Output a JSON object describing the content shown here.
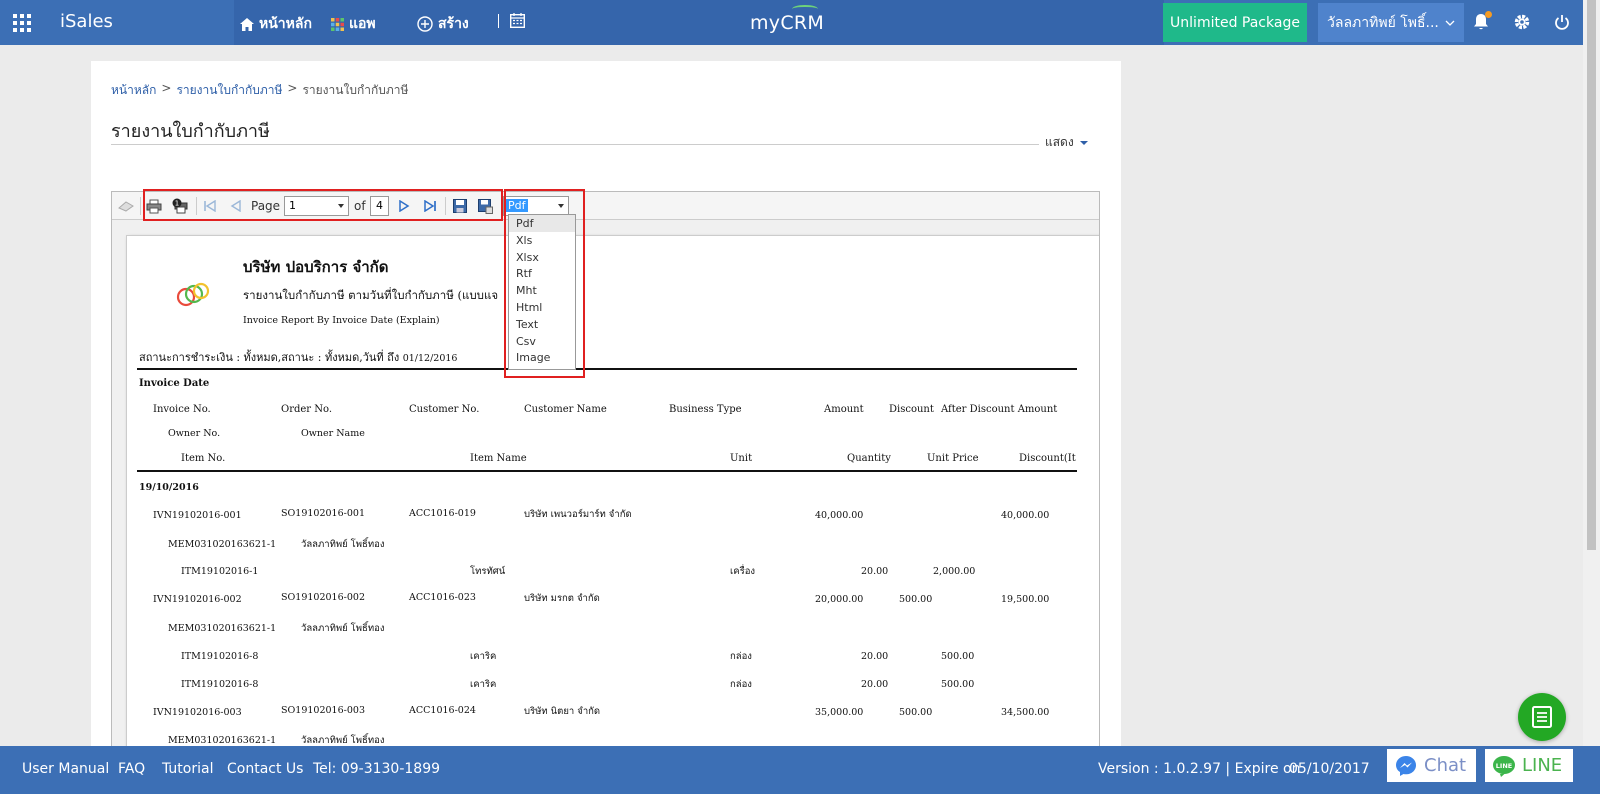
{
  "topbar": {
    "brand": "iSales",
    "nav": [
      {
        "label": "หน้าหลัก",
        "icon": "home-icon"
      },
      {
        "label": "แอพ",
        "icon": "apps-color-icon"
      },
      {
        "label": "สร้าง",
        "icon": "plus-circle-icon"
      }
    ],
    "logo": "myCRM",
    "package": "Unlimited Package",
    "user": "วัลลภาทิพย์ โพธิ์...",
    "colors": {
      "bar": "#3c6fb5",
      "package": "#1fb98a"
    }
  },
  "breadcrumb": {
    "items": [
      "หน้าหลัก",
      "รายงานใบกำกับภาษี",
      "รายงานใบกำกับภาษี"
    ],
    "separator": ">"
  },
  "page": {
    "title": "รายงานใบกำกับภาษี",
    "show_label": "แสดง"
  },
  "toolbar": {
    "page_label": "Page",
    "page_value": "1",
    "of_label": "of",
    "page_total": "4",
    "format_value": "Pdf"
  },
  "format_options": [
    "Pdf",
    "Xls",
    "Xlsx",
    "Rtf",
    "Mht",
    "Html",
    "Text",
    "Csv",
    "Image"
  ],
  "report": {
    "company": "บริษัท ปอบริการ จำกัด",
    "subtitle_th": "รายงานใบกำกับภาษี ตามวันที่ใบกำกับภาษี (แบบแจ",
    "subtitle_en": "Invoice Report By Invoice Date (Explain)",
    "status": "สถานะการชำระเงิน : ทั้งหมด,สถานะ : ทั้งหมด,วันที่ ถึง",
    "status_date": "01/12/2016",
    "group_header": "Invoice Date",
    "headers1": [
      "Invoice No.",
      "Order No.",
      "Customer No.",
      "Customer Name",
      "Business Type",
      "Amount",
      "Discount",
      "After Discount Amount"
    ],
    "headers2": [
      "Owner No.",
      "Owner Name"
    ],
    "headers3": [
      "Item No.",
      "Item Name",
      "Unit",
      "Quantity",
      "Unit Price",
      "Discount(It"
    ],
    "group_date": "19/10/2016",
    "rows": [
      {
        "inv": "IVN19102016-001",
        "order": "SO19102016-001",
        "cust": "ACC1016-019",
        "name": "บริษัท เพนวอร์มาร์ท จำกัด",
        "amount": "40,000.00",
        "discount": "",
        "after": "40,000.00",
        "owner_no": "MEM031020163621-1",
        "owner": "วัลลภาทิพย์ โพธิ์ทอง"
      },
      {
        "item_no": "ITM19102016-1",
        "item_name": "โทรทัศน์",
        "unit": "เครื่อง",
        "qty": "20.00",
        "price": "2,000.00"
      },
      {
        "inv": "IVN19102016-002",
        "order": "SO19102016-002",
        "cust": "ACC1016-023",
        "name": "บริษัท มรกต จำกัด",
        "amount": "20,000.00",
        "discount": "500.00",
        "after": "19,500.00",
        "owner_no": "MEM031020163621-1",
        "owner": "วัลลภาทิพย์ โพธิ์ทอง"
      },
      {
        "item_no": "ITM19102016-8",
        "item_name": "เคาริค",
        "unit": "กล่อง",
        "qty": "20.00",
        "price": "500.00"
      },
      {
        "item_no": "ITM19102016-8",
        "item_name": "เคาริค",
        "unit": "กล่อง",
        "qty": "20.00",
        "price": "500.00"
      },
      {
        "inv": "IVN19102016-003",
        "order": "SO19102016-003",
        "cust": "ACC1016-024",
        "name": "บริษัท นิตยา จำกัด",
        "amount": "35,000.00",
        "discount": "500.00",
        "after": "34,500.00",
        "owner_no": "MEM031020163621-1",
        "owner": "วัลลภาทิพย์ โพธิ์ทอง"
      }
    ]
  },
  "footer": {
    "links": [
      "User Manual",
      "FAQ",
      "Tutorial",
      "Contact Us",
      "Tel: 09-3130-1899"
    ],
    "version": "Version : 1.0.2.97 | Expire on",
    "expire": "05/10/2017",
    "chat": "Chat",
    "line": "LINE"
  }
}
